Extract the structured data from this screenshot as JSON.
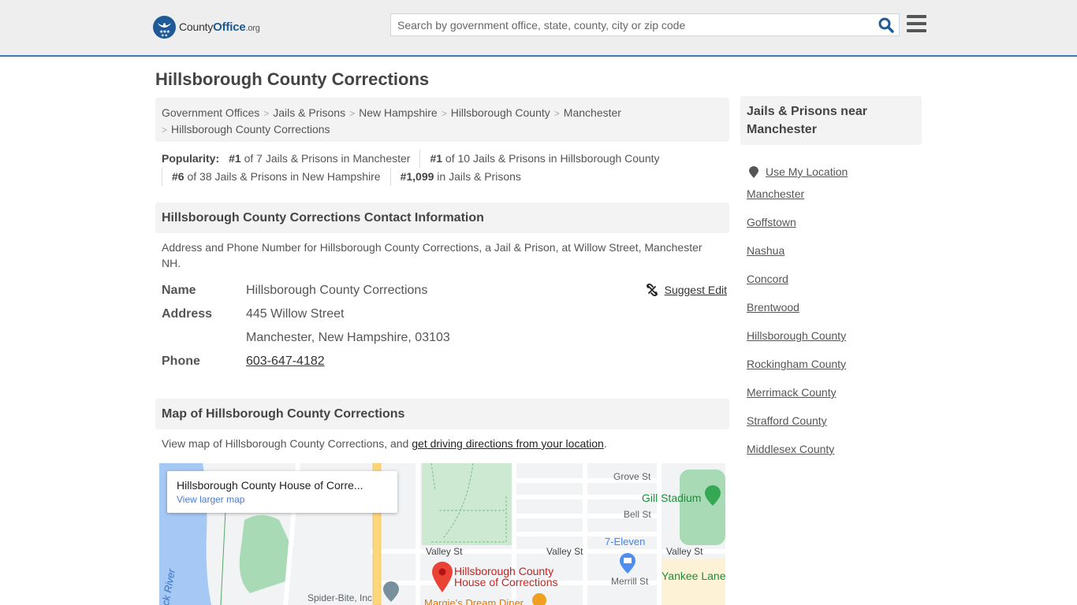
{
  "header": {
    "logo": {
      "name_part1": "County",
      "name_part2": "Office",
      "tld": ".org"
    },
    "search": {
      "placeholder": "Search by government office, state, county, city or zip code",
      "value": ""
    },
    "icons": {
      "search": "search-icon",
      "menu": "hamburger-menu-icon"
    }
  },
  "page": {
    "title": "Hillsborough County Corrections"
  },
  "breadcrumb": [
    "Government Offices",
    "Jails & Prisons",
    "New Hampshire",
    "Hillsborough County",
    "Manchester",
    "Hillsborough County Corrections"
  ],
  "popularity": {
    "label": "Popularity:",
    "items": [
      {
        "rank": "#1",
        "text": " of 7 Jails & Prisons in Manchester"
      },
      {
        "rank": "#1",
        "text": " of 10 Jails & Prisons in Hillsborough County"
      },
      {
        "rank": "#6",
        "text": " of 38 Jails & Prisons in New Hampshire"
      },
      {
        "rank": "#1,099",
        "text": " in Jails & Prisons"
      }
    ]
  },
  "contact": {
    "heading": "Hillsborough County Corrections Contact Information",
    "description": "Address and Phone Number for Hillsborough County Corrections, a Jail & Prison, at Willow Street, Manchester NH.",
    "suggest_edit": "Suggest Edit",
    "name_label": "Name",
    "name_value": "Hillsborough County Corrections",
    "address_label": "Address",
    "address_line1": "445 Willow Street",
    "address_line2": "Manchester, New Hampshire, 03103",
    "phone_label": "Phone",
    "phone_value": "603-647-4182"
  },
  "map_section": {
    "heading": "Map of Hillsborough County Corrections",
    "desc_prefix": "View map of Hillsborough County Corrections, and ",
    "desc_link": "get driving directions from your location",
    "desc_suffix": ".",
    "card_title": "Hillsborough County House of Corre...",
    "card_link": "View larger map",
    "labels": {
      "grove_st": "Grove St",
      "gill_stadium": "Gill Stadium",
      "bell_st": "Bell St",
      "seven_eleven": "7-Eleven",
      "valley_st": "Valley St",
      "marker_line1": "Hillsborough County",
      "marker_line2": "House of Corrections",
      "merrill_st": "Merrill St",
      "yankee_lanes": "Yankee Lanes",
      "spider_bite": "Spider-Bite, Inc",
      "margies": "Margie's Dream Diner",
      "river": "ck River"
    },
    "colors": {
      "water": "#a6c8f5",
      "park": "#a8dab5",
      "road_major": "#fdd67c",
      "marker": "#ea4335"
    }
  },
  "sidebar": {
    "heading": "Jails & Prisons near Manchester",
    "use_location": "Use My Location",
    "links": [
      "Manchester",
      "Goffstown",
      "Nashua",
      "Concord",
      "Brentwood",
      "Hillsborough County",
      "Rockingham County",
      "Merrimack County",
      "Strafford County",
      "Middlesex County"
    ]
  },
  "colors": {
    "brand": "#1f5a96",
    "header_border": "#3b7bb3",
    "panel_bg": "#f3f3f3"
  }
}
